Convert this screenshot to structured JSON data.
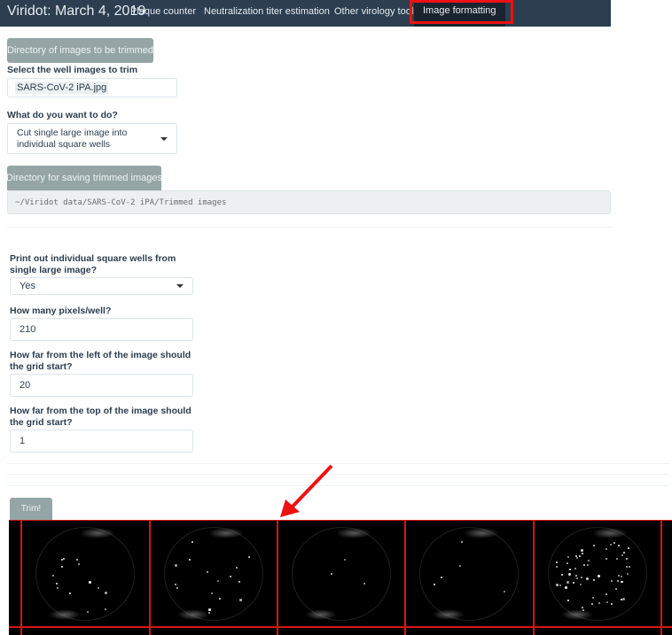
{
  "navbar": {
    "brand": "Viridot: March 4, 2019",
    "items": [
      {
        "label": "Plaque counter",
        "active": false
      },
      {
        "label": "Neutralization titer estimation",
        "active": false
      },
      {
        "label": "Other virology tools",
        "active": false
      },
      {
        "label": "Image formatting",
        "active": true
      }
    ]
  },
  "form": {
    "dir_images_button": "Directory of images to be trimmed",
    "select_images_label": "Select the well images to trim",
    "selected_file": "SARS-CoV-2 iPA.jpg",
    "action_label": "What do you want to do?",
    "action_value": "Cut single large image into individual square wells",
    "dir_save_button": "Directory for saving trimmed images",
    "save_path": "~/Viridot data/SARS-CoV-2 iPA/Trimmed images",
    "print_wells_label": "Print out individual square wells from single large image?",
    "print_wells_value": "Yes",
    "pixels_label": "How many pixels/well?",
    "pixels_value": "210",
    "left_label": "How far from the left of the image should the grid start?",
    "left_value": "20",
    "top_label": "How far from the top of the image should the grid start?",
    "top_value": "1",
    "trim_button": "Trim!"
  },
  "preview": {
    "description": "Plate image with red trimming grid overlay",
    "grid_color": "#d51515",
    "wells": 5
  },
  "annotations": {
    "highlight_color": "#ee1111",
    "highlight_target": "Image formatting",
    "arrow_target": "grid line"
  }
}
